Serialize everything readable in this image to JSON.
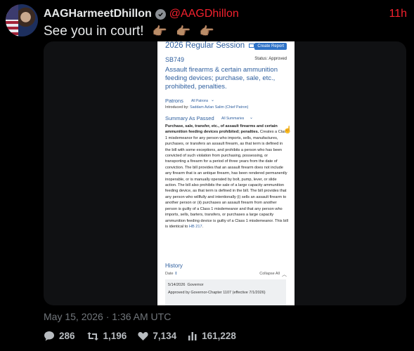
{
  "author": {
    "display_name": "AAGHarmeetDhillon",
    "handle": "@AAGDhillon",
    "time_ago": "11h",
    "verified": true
  },
  "tweet": {
    "text": "See you in court!",
    "emoji": [
      "👉🏽",
      "👉🏽",
      "👉🏽"
    ],
    "timestamp": "May 15, 2026 · 1:36 AM UTC"
  },
  "document": {
    "session_title": "2026 Regular Session",
    "create_report_label": "Create Report",
    "bill_number": "SB749",
    "status": "Status: Approved",
    "bill_title": "Assault firearms & certain ammunition feeding devices; purchase, sale, etc., prohibited, penalties.",
    "patrons_label": "Patrons",
    "all_patrons_label": "All Patrons",
    "introduced_by_label": "Introduced by:",
    "introduced_by_name": "Saddam Azlan Salim (Chief Patron)",
    "summary_label": "Summary As Passed",
    "all_summaries_label": "All Summaries",
    "summary_bold": "Purchase, sale, transfer, etc., of assault firearms and certain ammunition feeding devices prohibited; penalties.",
    "summary_body": "Creates a Class 1 misdemeanor for any person who imports, sells, manufactures, purchases, or transfers an assault firearm, as that term is defined in the bill with some exceptions, and prohibits a person who has been convicted of such violation from purchasing, possessing, or transporting a firearm for a period of three years from the date of conviction. The bill provides that an assault firearm does not include any firearm that is an antique firearm, has been rendered permanently inoperable, or is manually operated by bolt, pump, lever, or slide action. The bill also prohibits the sale of a large capacity ammunition feeding device, as that term is defined in the bill. The bill provides that any person who willfully and intentionally (i) sells an assault firearm to another person or (ii) purchases an assault firearm from another person is guilty of a Class 1 misdemeanor and that any person who imports, sells, barters, transfers, or purchases a large capacity ammunition feeding device is guilty of a Class 1 misdemeanor. This bill is identical to",
    "summary_link": "HB 217",
    "history_label": "History",
    "date_label": "Date",
    "collapse_all_label": "Collapse All",
    "history_entry_date": "5/14/2026",
    "history_entry_actor": "Governor",
    "history_entry_action": "Approved by Governor-Chapter 1107 (effective 7/1/2026)"
  },
  "stats": {
    "replies": "286",
    "reposts": "1,196",
    "likes": "7,134",
    "views": "161,228"
  },
  "colors": {
    "handle": "#f4212e",
    "link_blue": "#2d5e9e",
    "muted": "#71767b"
  }
}
